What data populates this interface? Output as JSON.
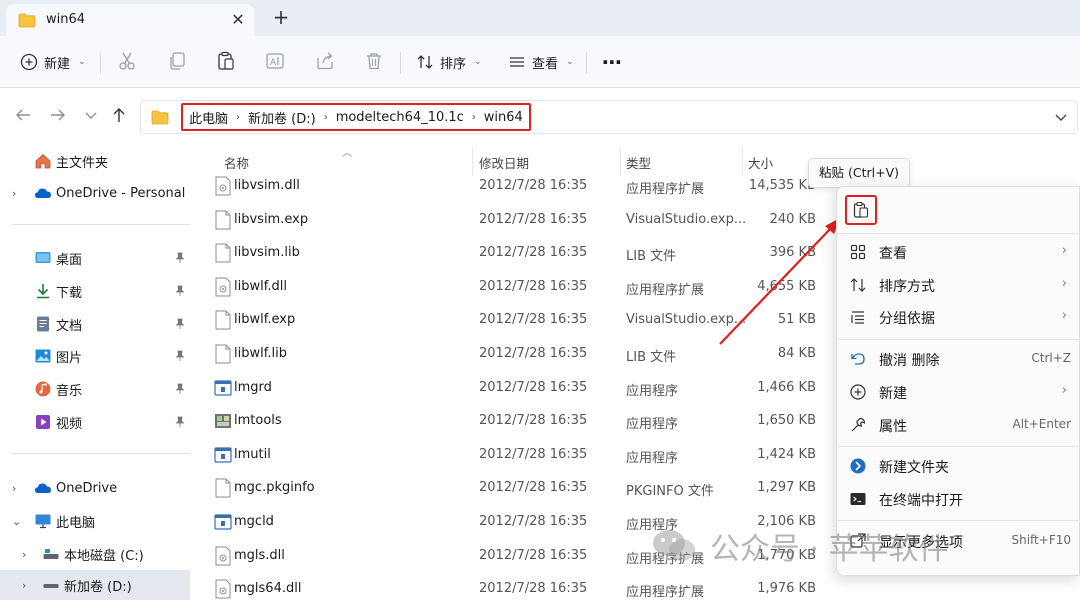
{
  "window": {
    "tab_title": "win64",
    "close_glyph": "✕",
    "new_tab_glyph": "+"
  },
  "toolbar": {
    "new_label": "新建",
    "sort_label": "排序",
    "view_label": "查看",
    "more_glyph": "⋯",
    "icons": [
      "cut-icon",
      "copy-icon",
      "paste-icon",
      "rename-icon",
      "share-icon",
      "delete-icon"
    ]
  },
  "address": {
    "crumbs": [
      "此电脑",
      "新加卷 (D:)",
      "modeltech64_10.1c",
      "win64"
    ],
    "crumb_sep": "›",
    "highlight_color": "#e0201e"
  },
  "sidebar": {
    "home": "主文件夹",
    "onedrive_personal": "OneDrive - Personal",
    "quick": [
      "桌面",
      "下载",
      "文档",
      "图片",
      "音乐",
      "视频"
    ],
    "onedrive": "OneDrive",
    "this_pc": "此电脑",
    "local_c": "本地磁盘 (C:)",
    "new_vol_d": "新加卷 (D:)"
  },
  "columns": {
    "name": "名称",
    "modified": "修改日期",
    "type": "类型",
    "size": "大小"
  },
  "files": [
    {
      "name": "libvsim.dll",
      "date": "2012/7/28 16:35",
      "type": "应用程序扩展",
      "size": "14,535 KB",
      "icon": "dll-icon"
    },
    {
      "name": "libvsim.exp",
      "date": "2012/7/28 16:35",
      "type": "VisualStudio.exp...",
      "size": "240 KB",
      "icon": "file-icon"
    },
    {
      "name": "libvsim.lib",
      "date": "2012/7/28 16:35",
      "type": "LIB 文件",
      "size": "396 KB",
      "icon": "file-icon"
    },
    {
      "name": "libwlf.dll",
      "date": "2012/7/28 16:35",
      "type": "应用程序扩展",
      "size": "4,655 KB",
      "icon": "dll-icon"
    },
    {
      "name": "libwlf.exp",
      "date": "2012/7/28 16:35",
      "type": "VisualStudio.exp...",
      "size": "51 KB",
      "icon": "file-icon"
    },
    {
      "name": "libwlf.lib",
      "date": "2012/7/28 16:35",
      "type": "LIB 文件",
      "size": "84 KB",
      "icon": "file-icon"
    },
    {
      "name": "lmgrd",
      "date": "2012/7/28 16:35",
      "type": "应用程序",
      "size": "1,466 KB",
      "icon": "exe-icon"
    },
    {
      "name": "lmtools",
      "date": "2012/7/28 16:35",
      "type": "应用程序",
      "size": "1,650 KB",
      "icon": "lmtools-icon"
    },
    {
      "name": "lmutil",
      "date": "2012/7/28 16:35",
      "type": "应用程序",
      "size": "1,424 KB",
      "icon": "exe-icon"
    },
    {
      "name": "mgc.pkginfo",
      "date": "2012/7/28 16:35",
      "type": "PKGINFO 文件",
      "size": "1,297 KB",
      "icon": "file-icon"
    },
    {
      "name": "mgcld",
      "date": "2012/7/28 16:35",
      "type": "应用程序",
      "size": "2,106 KB",
      "icon": "exe-icon"
    },
    {
      "name": "mgls.dll",
      "date": "2012/7/28 16:35",
      "type": "应用程序扩展",
      "size": "1,770 KB",
      "icon": "dll-icon"
    },
    {
      "name": "mgls64.dll",
      "date": "2012/7/28 16:35",
      "type": "应用程序扩展",
      "size": "1,976 KB",
      "icon": "dll-icon"
    }
  ],
  "context_menu": {
    "paste_tooltip": "粘贴 (Ctrl+V)",
    "view": "查看",
    "sort_by": "排序方式",
    "group_by": "分组依据",
    "undo_delete": "撤消 删除",
    "undo_shortcut": "Ctrl+Z",
    "new": "新建",
    "properties": "属性",
    "properties_shortcut": "Alt+Enter",
    "new_folder": "新建文件夹",
    "open_terminal": "在终端中打开",
    "more_options": "显示更多选项",
    "more_shortcut": "Shift+F10",
    "submenu_glyph": "›"
  },
  "watermark": {
    "text": "公众号 · 苹苹软件"
  },
  "colors": {
    "accent": "#0067c0",
    "annotation_red": "#e0201e",
    "folder_yellow": "#f5c443"
  }
}
